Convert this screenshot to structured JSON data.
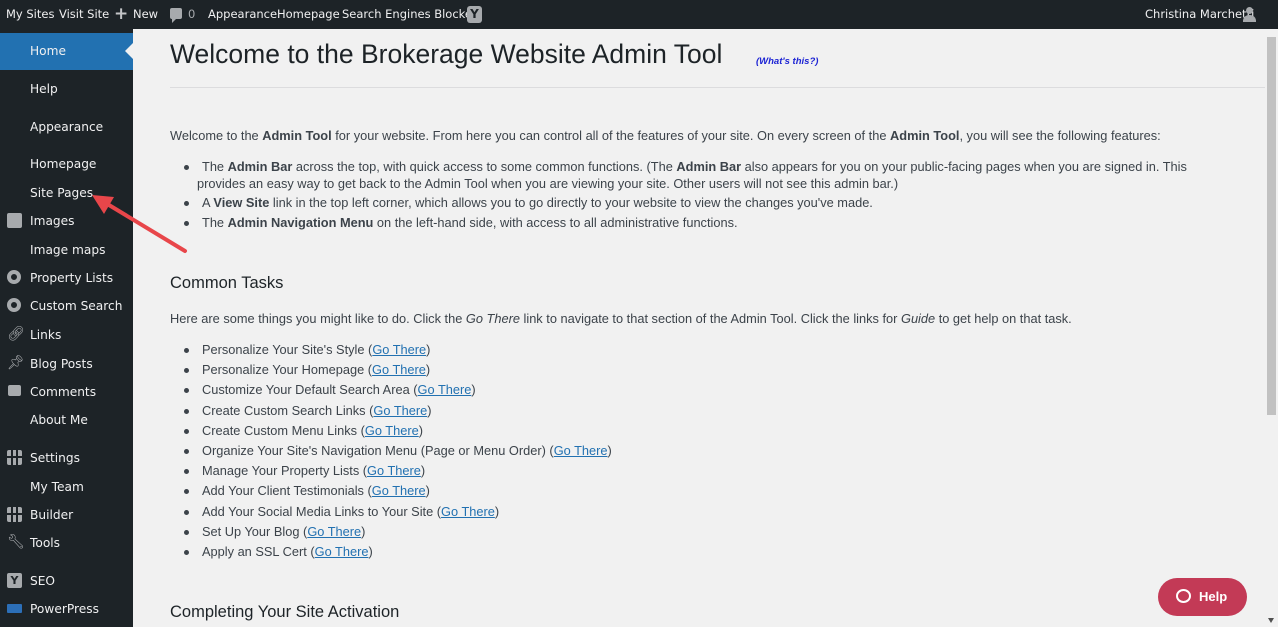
{
  "adminbar": {
    "my_sites": "My Sites",
    "visit_site": "Visit Site",
    "new_label": "New",
    "comments_count": "0",
    "appearance": "Appearance",
    "homepage": "Homepage",
    "search_engines": "Search Engines Blocked",
    "user_name": "Christina Marchetti",
    "yoast_letter": "Y"
  },
  "sidebar": {
    "items": [
      {
        "label": "Home",
        "icon": null,
        "current": true
      },
      {
        "label": "Help",
        "icon": null
      },
      {
        "label": "Appearance",
        "icon": null
      },
      {
        "label": "Homepage",
        "icon": null
      },
      {
        "label": "Site Pages",
        "icon": null
      },
      {
        "label": "Images",
        "icon": "images-icon"
      },
      {
        "label": "Image maps",
        "icon": null
      },
      {
        "label": "Property Lists",
        "icon": "gear-icon"
      },
      {
        "label": "Custom Search",
        "icon": "gear-icon"
      },
      {
        "label": "Links",
        "icon": "link-icon"
      },
      {
        "label": "Blog Posts",
        "icon": "pin-icon"
      },
      {
        "label": "Comments",
        "icon": "comment-icon"
      },
      {
        "label": "About Me",
        "icon": null
      },
      {
        "label": "Settings",
        "icon": "settings-icon"
      },
      {
        "label": "My Team",
        "icon": null
      },
      {
        "label": "Builder",
        "icon": "grid-icon"
      },
      {
        "label": "Tools",
        "icon": "wrench-icon"
      },
      {
        "label": "SEO",
        "icon": "yoast-icon"
      },
      {
        "label": "PowerPress",
        "icon": "powerpress-icon"
      }
    ]
  },
  "content": {
    "title": "Welcome to the Brokerage Website Admin Tool",
    "whats_this": "(What's this?)",
    "intro": {
      "t1": "Welcome to the ",
      "b1": "Admin Tool",
      "t2": " for your website. From here you can control all of the features of your site. On every screen of the ",
      "b2": "Admin Tool",
      "t3": ", you will see the following features:"
    },
    "features": [
      {
        "pre": "The ",
        "bold": "Admin Bar",
        "mid": " across the top, with quick access to some common functions. (The ",
        "bold2": "Admin Bar",
        "post": " also appears for you on your public-facing pages when you are signed in. This",
        "line2": "provides an easy way to get back to the Admin Tool when you are viewing your site. Other users will not see this admin bar.)"
      },
      {
        "pre": "A ",
        "bold": "View Site",
        "post": " link in the top left corner, which allows you to go directly to your website to view the changes you've made."
      },
      {
        "pre": "The ",
        "bold": "Admin Navigation Menu",
        "post": " on the left-hand side, with access to all administrative functions."
      }
    ],
    "common_tasks_heading": "Common Tasks",
    "tasks_intro": {
      "t1": "Here are some things you might like to do. Click the ",
      "i1": "Go There",
      "t2": " link to navigate to that section of the Admin Tool. Click the links for ",
      "i2": "Guide",
      "t3": " to get help on that task."
    },
    "go_there": "Go There",
    "tasks": [
      "Personalize Your Site's Style",
      "Personalize Your Homepage",
      "Customize Your Default Search Area",
      "Create Custom Search Links",
      "Create Custom Menu Links",
      "Organize Your Site's Navigation Menu (Page or Menu Order)",
      "Manage Your Property Lists",
      "Add Your Client Testimonials",
      "Add Your Social Media Links to Your Site",
      "Set Up Your Blog",
      "Apply an SSL Cert"
    ],
    "completing_heading": "Completing Your Site Activation"
  },
  "help_button": {
    "label": "Help"
  },
  "colors": {
    "admin_dark": "#1d2327",
    "accent_blue": "#2271b1",
    "help_red": "#c33a56",
    "annotation_arrow": "#e8464a"
  }
}
